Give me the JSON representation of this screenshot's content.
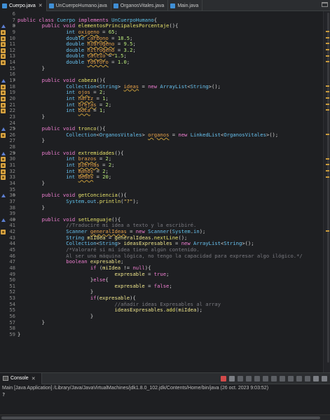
{
  "tabs": [
    {
      "label": "Cuerpo.java",
      "active": true,
      "close": "✕"
    },
    {
      "label": "UnCuerpoHumano.java",
      "active": false
    },
    {
      "label": "OrganosVitales.java",
      "active": false
    },
    {
      "label": "Main.java",
      "active": false
    }
  ],
  "editor": {
    "lines": [
      {
        "n": "6",
        "m": "",
        "f": "",
        "t": ""
      },
      {
        "n": "7",
        "m": "",
        "f": "",
        "t": "<span class='kw'>public</span> <span class='kw'>class</span> <span class='cls'>Cuerpo</span> <span class='kw'>implements</span> <span class='cls'>UnCuerpoHumano</span>{"
      },
      {
        "n": "8",
        "m": "ovr",
        "f": "⊖",
        "t": "        <span class='kw'>public</span> <span class='kw'>void</span> <span class='fn'>elementosPrincipalesPorcentaje</span>(){"
      },
      {
        "n": "9",
        "m": "warn",
        "f": "",
        "t": "                <span class='ty'>int</span> <span class='fld'>oxigeno</span> = <span class='num'>65</span>;"
      },
      {
        "n": "10",
        "m": "warn",
        "f": "",
        "t": "                <span class='ty'>double</span> <span class='fld'>carbono</span> = <span class='num'>18.5</span>;"
      },
      {
        "n": "11",
        "m": "warn",
        "f": "",
        "t": "                <span class='ty'>double</span> <span class='fld'>hidrogeno</span> = <span class='num'>9.5</span>;"
      },
      {
        "n": "12",
        "m": "warn",
        "f": "",
        "t": "                <span class='ty'>double</span> <span class='fld'>nitrogeno</span> = <span class='num'>3.2</span>;"
      },
      {
        "n": "13",
        "m": "warn",
        "f": "",
        "t": "                <span class='ty'>double</span> <span class='fld'>calcio</span> = <span class='num'>1.5</span>;"
      },
      {
        "n": "14",
        "m": "warn",
        "f": "",
        "t": "                <span class='ty'>double</span> <span class='fld'>fosforo</span> = <span class='num'>1.0</span>;"
      },
      {
        "n": "15",
        "m": "",
        "f": "",
        "t": "        }"
      },
      {
        "n": "16",
        "m": "",
        "f": "",
        "t": ""
      },
      {
        "n": "17",
        "m": "ovr",
        "f": "⊖",
        "t": "        <span class='kw'>public</span> <span class='kw'>void</span> <span class='fn'>cabeza</span>(){"
      },
      {
        "n": "18",
        "m": "warn",
        "f": "",
        "t": "                <span class='ty'>Collection</span>&lt;<span class='ty'>String</span>&gt; <span class='fld'>ideas</span> = <span class='kw'>new</span> <span class='ty'>ArrayList</span>&lt;<span class='ty'>String</span>&gt;();"
      },
      {
        "n": "19",
        "m": "warn",
        "f": "",
        "t": "                <span class='ty'>int</span> <span class='fld'>ojos</span> = <span class='num'>2</span>;"
      },
      {
        "n": "20",
        "m": "warn",
        "f": "",
        "t": "                <span class='ty'>int</span> <span class='fld'>nariz</span> = <span class='num'>1</span>;"
      },
      {
        "n": "21",
        "m": "warn",
        "f": "",
        "t": "                <span class='ty'>int</span> <span class='fld'>orejas</span> = <span class='num'>2</span>;"
      },
      {
        "n": "22",
        "m": "warn",
        "f": "",
        "t": "                <span class='ty'>int</span> <span class='fld'>boca</span> = <span class='num'>1</span>;"
      },
      {
        "n": "23",
        "m": "",
        "f": "",
        "t": "        }"
      },
      {
        "n": "24",
        "m": "",
        "f": "",
        "t": ""
      },
      {
        "n": "25",
        "m": "ovr",
        "f": "⊖",
        "t": "        <span class='kw'>public</span> <span class='kw'>void</span> <span class='fn'>tronco</span>(){"
      },
      {
        "n": "26",
        "m": "warn",
        "f": "",
        "t": "                <span class='ty'>Collection</span>&lt;<span class='ty'>OrganosVitales</span>&gt; <span class='fld'>organos</span> = <span class='kw'>new</span> <span class='ty'>LinkedList</span>&lt;<span class='ty'>OrganosVitales</span>&gt;();"
      },
      {
        "n": "27",
        "m": "",
        "f": "",
        "t": "        }"
      },
      {
        "n": "28",
        "m": "",
        "f": "",
        "t": ""
      },
      {
        "n": "29",
        "m": "ovr",
        "f": "⊖",
        "t": "        <span class='kw'>public</span> <span class='kw'>void</span> <span class='fn'>extremidades</span>(){"
      },
      {
        "n": "30",
        "m": "warn",
        "f": "",
        "t": "                <span class='ty'>int</span> <span class='fld'>brazos</span> = <span class='num'>2</span>;"
      },
      {
        "n": "31",
        "m": "warn",
        "f": "",
        "t": "                <span class='ty'>int</span> <span class='fld'>piernas</span> = <span class='num'>2</span>;"
      },
      {
        "n": "32",
        "m": "warn",
        "f": "",
        "t": "                <span class='ty'>int</span> <span class='fld'>manos</span> = <span class='num'>2</span>;"
      },
      {
        "n": "33",
        "m": "warn",
        "f": "",
        "t": "                <span class='ty'>int</span> <span class='fld'>dedos</span> = <span class='num'>20</span>;"
      },
      {
        "n": "34",
        "m": "",
        "f": "",
        "t": "        }"
      },
      {
        "n": "35",
        "m": "",
        "f": "",
        "t": ""
      },
      {
        "n": "36",
        "m": "ovr",
        "f": "⊖",
        "t": "        <span class='kw'>public</span> <span class='kw'>void</span> <span class='fn'>getConciencia</span>(){"
      },
      {
        "n": "37",
        "m": "",
        "f": "",
        "t": "                <span class='cls'>System</span>.<span class='ty'>out</span>.<span class='fn'>println</span>(<span class='str'>\"?\"</span>);"
      },
      {
        "n": "38",
        "m": "",
        "f": "",
        "t": "        }"
      },
      {
        "n": "39",
        "m": "",
        "f": "",
        "t": ""
      },
      {
        "n": "40",
        "m": "ovr",
        "f": "⊖",
        "t": "        <span class='kw'>public</span> <span class='kw'>void</span> <span class='fn'>setLenguaje</span>(){"
      },
      {
        "n": "41",
        "m": "",
        "f": "",
        "t": "                <span class='cm'>//Traduciré mi idea a texto y la escribiré.</span>"
      },
      {
        "n": "42",
        "m": "warn",
        "f": "",
        "t": "                <span class='ty'>Scanner</span> <span class='fld'>generalIdeas</span> = <span class='kw'>new</span> <span class='ty'>Scanner</span>(<span class='cls'>System</span>.<span class='ty'>in</span>);"
      },
      {
        "n": "43",
        "m": "",
        "f": "",
        "t": "                <span class='ty'>String</span> <span class='var'>miIdea</span> = <span class='var'>generalIdeas</span>.<span class='fn'>nextLine</span>();"
      },
      {
        "n": "44",
        "m": "",
        "f": "",
        "t": "                <span class='ty'>Collection</span>&lt;<span class='ty'>String</span>&gt; <span class='var'>ideasExpresables</span> = <span class='kw'>new</span> <span class='ty'>ArrayList</span>&lt;<span class='ty'>String</span>&gt;();"
      },
      {
        "n": "45",
        "m": "",
        "f": "",
        "t": "                <span class='cm'>/*Valoraré si mi idea tiene algún contenido.</span>"
      },
      {
        "n": "46",
        "m": "",
        "f": "",
        "t": "<span class='cm'>                Al ser una máquina lógica, no tengo la capacidad para expresar algo ilógico.*/</span>"
      },
      {
        "n": "47",
        "m": "",
        "f": "",
        "t": "                <span class='kw'>boolean</span> <span class='var'>expresable</span>;"
      },
      {
        "n": "48",
        "m": "",
        "f": "",
        "t": "                        <span class='kw'>if</span> (<span class='var'>miIdea</span> != <span class='kw'>null</span>){"
      },
      {
        "n": "49",
        "m": "",
        "f": "",
        "t": "                                <span class='var'>expresable</span> = <span class='kw'>true</span>;"
      },
      {
        "n": "50",
        "m": "",
        "f": "",
        "t": "                        }<span class='kw'>else</span>{"
      },
      {
        "n": "51",
        "m": "",
        "f": "",
        "t": "                                <span class='var'>expresable</span> = <span class='kw'>false</span>;"
      },
      {
        "n": "52",
        "m": "",
        "f": "",
        "t": "                        }"
      },
      {
        "n": "53",
        "m": "",
        "f": "",
        "t": "                        <span class='kw'>if</span>(<span class='var'>expresable</span>){"
      },
      {
        "n": "54",
        "m": "",
        "f": "",
        "t": "                                <span class='cm'>//añadir ideas Expresables al array</span>"
      },
      {
        "n": "55",
        "m": "",
        "f": "",
        "t": "                                <span class='var'>ideasExpresables</span>.<span class='fn'>add</span>(<span class='var'>miIdea</span>);"
      },
      {
        "n": "56",
        "m": "",
        "f": "",
        "t": "                        }"
      },
      {
        "n": "57",
        "m": "",
        "f": "",
        "t": "        }"
      },
      {
        "n": "58",
        "m": "",
        "f": "",
        "t": ""
      },
      {
        "n": "59",
        "m": "",
        "f": "",
        "t": "}"
      }
    ]
  },
  "console": {
    "tab_label": "Console",
    "close": "✕",
    "status": "Main [Java Application] /Library/Java/JavaVirtualMachines/jdk1.8.0_102.jdk/Contents/Home/bin/java (26 oct. 2023 9:03:52)",
    "output": "?"
  },
  "colors": {
    "accent": "#3f8fd6",
    "warning": "#d9a441",
    "background": "#1e1f22"
  },
  "icons": [
    "java-file-icon",
    "close-icon",
    "minimize-icon",
    "warning-marker-icon",
    "override-marker-icon",
    "fold-icon",
    "console-icon",
    "terminate-icon",
    "toolbar-icons"
  ]
}
